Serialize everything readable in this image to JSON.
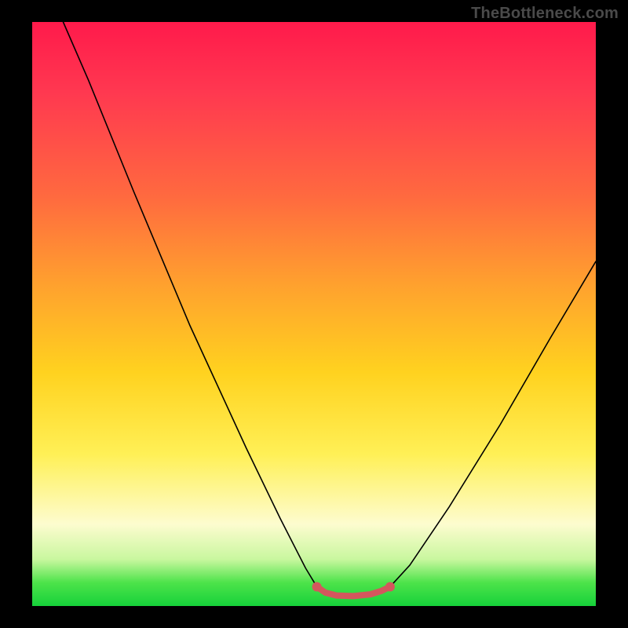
{
  "watermark": "TheBottleneck.com",
  "chart_data": {
    "type": "line",
    "title": "",
    "xlabel": "",
    "ylabel": "",
    "xlim": [
      0,
      100
    ],
    "ylim": [
      0,
      100
    ],
    "grid": false,
    "legend": false,
    "background_gradient": {
      "direction": "vertical",
      "stops": [
        {
          "pos": 0.0,
          "color": "#ff1a4b"
        },
        {
          "pos": 0.5,
          "color": "#ffc21f"
        },
        {
          "pos": 0.82,
          "color": "#fffabe"
        },
        {
          "pos": 1.0,
          "color": "#16d13a"
        }
      ]
    },
    "series": [
      {
        "name": "left-descent",
        "color": "#000000",
        "stroke_width": 1.6,
        "points": [
          {
            "x": 5.5,
            "y": 100.0
          },
          {
            "x": 10.0,
            "y": 90.0
          },
          {
            "x": 18.0,
            "y": 71.0
          },
          {
            "x": 28.0,
            "y": 48.0
          },
          {
            "x": 38.0,
            "y": 27.0
          },
          {
            "x": 44.0,
            "y": 15.0
          },
          {
            "x": 48.5,
            "y": 6.5
          },
          {
            "x": 50.5,
            "y": 3.3
          }
        ]
      },
      {
        "name": "right-ascent",
        "color": "#000000",
        "stroke_width": 1.6,
        "points": [
          {
            "x": 63.5,
            "y": 3.3
          },
          {
            "x": 67.0,
            "y": 7.0
          },
          {
            "x": 74.0,
            "y": 17.0
          },
          {
            "x": 83.0,
            "y": 31.0
          },
          {
            "x": 92.0,
            "y": 46.0
          },
          {
            "x": 100.0,
            "y": 59.0
          }
        ]
      },
      {
        "name": "valley-floor",
        "color": "#d4575d",
        "stroke_width": 8,
        "points": [
          {
            "x": 50.5,
            "y": 3.3
          },
          {
            "x": 52.0,
            "y": 2.3
          },
          {
            "x": 54.0,
            "y": 1.8
          },
          {
            "x": 57.0,
            "y": 1.7
          },
          {
            "x": 60.0,
            "y": 2.0
          },
          {
            "x": 62.0,
            "y": 2.6
          },
          {
            "x": 63.5,
            "y": 3.3
          }
        ]
      }
    ],
    "markers": [
      {
        "name": "valley-left-cap",
        "x": 50.5,
        "y": 3.3,
        "r": 6,
        "color": "#d4575d"
      },
      {
        "name": "valley-right-cap",
        "x": 63.5,
        "y": 3.3,
        "r": 6,
        "color": "#d4575d"
      }
    ]
  }
}
